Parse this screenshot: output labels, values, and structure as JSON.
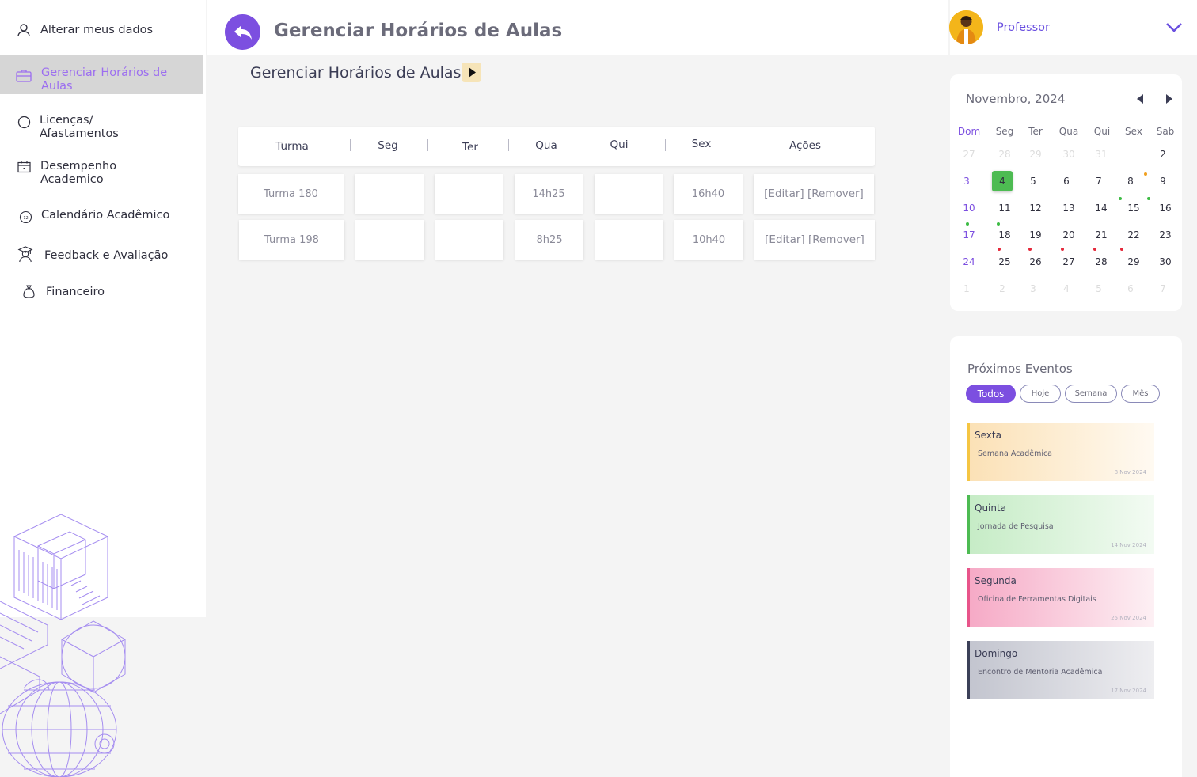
{
  "sidebar": {
    "items": [
      {
        "label": "Alterar meus dados"
      },
      {
        "label": "Gerenciar Horários de Aulas"
      },
      {
        "label": "Licenças/ Afastamentos"
      },
      {
        "label": "Desempenho Academico"
      },
      {
        "label": "Calendário Acadêmico"
      },
      {
        "label": "Feedback e Avaliação"
      },
      {
        "label": "Financeiro"
      }
    ]
  },
  "header": {
    "title": "Gerenciar Horários de Aulas",
    "user_role": "Professor"
  },
  "main": {
    "subtitle": "Gerenciar Horários de Aulas",
    "table": {
      "columns": [
        "Turma",
        "Seg",
        "Ter",
        "Qua",
        "Qui",
        "Sex",
        "Ações"
      ],
      "rows": [
        {
          "turma": "Turma 180",
          "seg": "",
          "ter": "",
          "qua": "14h25",
          "qui": "",
          "sex": "16h40",
          "acoes": "[Editar] [Remover]"
        },
        {
          "turma": "Turma 198",
          "seg": "",
          "ter": "",
          "qua": "8h25",
          "qui": "",
          "sex": "10h40",
          "acoes": "[Editar] [Remover]"
        }
      ]
    }
  },
  "calendar": {
    "title": "Novembro, 2024",
    "weekdays": [
      "Dom",
      "Seg",
      "Ter",
      "Qua",
      "Qui",
      "Sex",
      "Sab"
    ],
    "weeks": [
      [
        "27",
        "28",
        "29",
        "30",
        "31",
        "",
        "2"
      ],
      [
        "3",
        "4",
        "5",
        "6",
        "7",
        "8",
        "9"
      ],
      [
        "10",
        "11",
        "12",
        "13",
        "14",
        "15",
        "16"
      ],
      [
        "17",
        "18",
        "19",
        "20",
        "21",
        "22",
        "23"
      ],
      [
        "24",
        "25",
        "26",
        "27",
        "28",
        "29",
        "30"
      ],
      [
        "1",
        "2",
        "3",
        "4",
        "5",
        "6",
        "7"
      ]
    ],
    "today": "4",
    "event_colors": {
      "green": "#3dbb45",
      "red": "#e5283a",
      "orange": "#f0a020"
    }
  },
  "events": {
    "title": "Próximos Eventos",
    "filters": [
      "Todos",
      "Hoje",
      "Semana",
      "Mês"
    ],
    "active_filter": "Todos",
    "items": [
      {
        "day": "Sexta",
        "name": "Semana Acadêmica",
        "date": "8 Nov 2024",
        "color": "#f5c542"
      },
      {
        "day": "Quinta",
        "name": "Jornada de Pesquisa",
        "date": "14 Nov 2024",
        "color": "#4dbb52"
      },
      {
        "day": "Segunda",
        "name": "Oficina de Ferramentas Digitais",
        "date": "25 Nov 2024",
        "color": "#e8548a"
      },
      {
        "day": "Domingo",
        "name": "Encontro de Mentoria Acadêmica",
        "date": "17 Nov 2024",
        "color": "#3b4058"
      }
    ]
  },
  "colors": {
    "accent": "#7c4fe0",
    "active_nav_bg": "#d6d6d6"
  }
}
